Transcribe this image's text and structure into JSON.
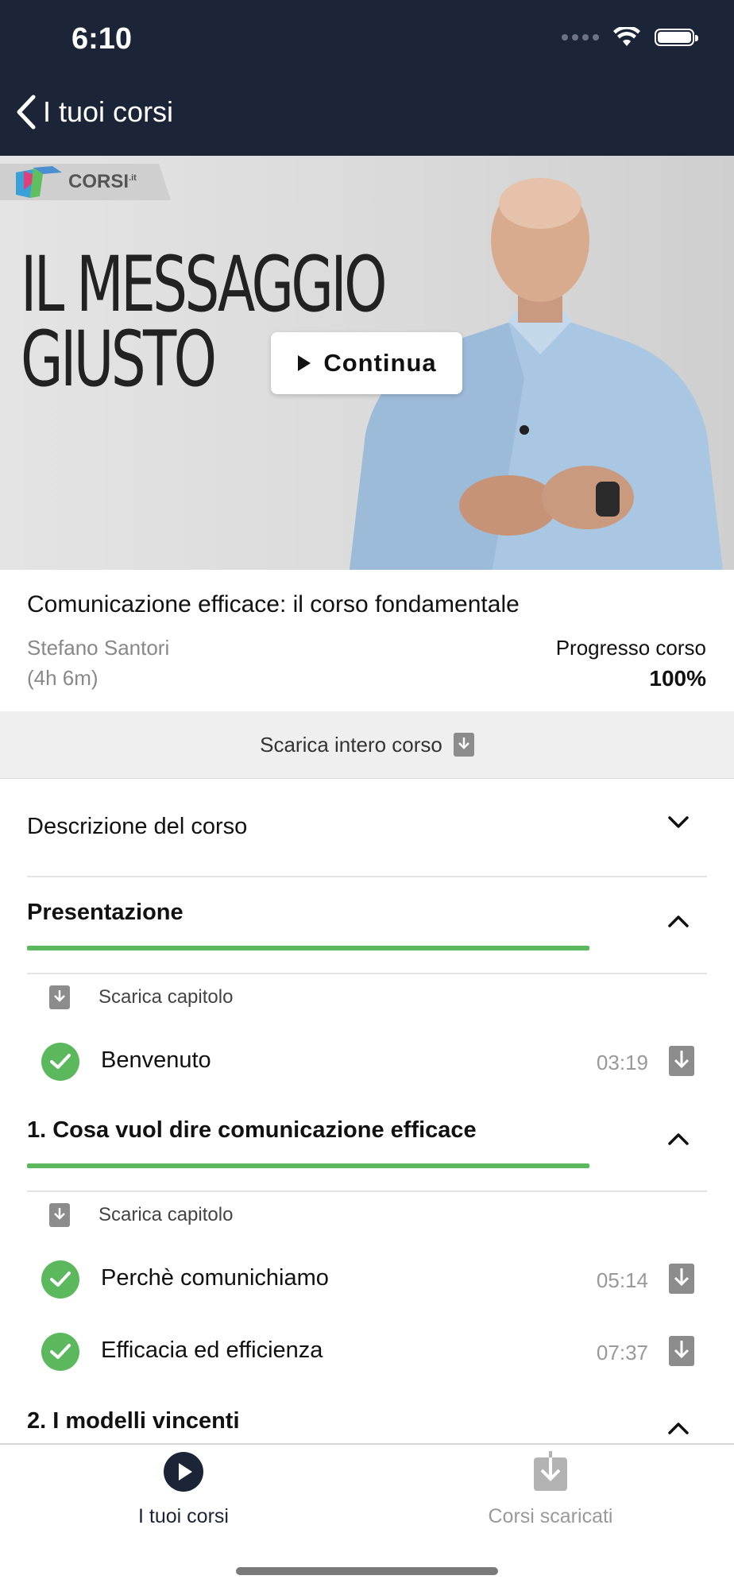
{
  "status_bar": {
    "time": "6:10"
  },
  "header": {
    "back_label": "I tuoi corsi"
  },
  "video": {
    "logo_text": "CORSI",
    "logo_suffix": ".it",
    "title_line1": "IL MESSAGGIO",
    "title_line2": "GIUSTO",
    "continue_label": "Continua"
  },
  "course": {
    "title": "Comunicazione efficace: il corso fondamentale",
    "author": "Stefano Santori",
    "duration": "(4h 6m)",
    "progress_label": "Progresso corso",
    "progress_value": "100%",
    "download_all_label": "Scarica intero corso",
    "description_label": "Descrizione del corso"
  },
  "sections": [
    {
      "title": "Presentazione",
      "progress": 1.0,
      "download_label": "Scarica capitolo",
      "lessons": [
        {
          "title": "Benvenuto",
          "duration": "03:19",
          "completed": true
        }
      ]
    },
    {
      "title": "1. Cosa vuol dire comunicazione efficace",
      "progress": 1.0,
      "download_label": "Scarica capitolo",
      "lessons": [
        {
          "title": "Perchè comunichiamo",
          "duration": "05:14",
          "completed": true
        },
        {
          "title": "Efficacia ed efficienza",
          "duration": "07:37",
          "completed": true
        }
      ]
    },
    {
      "title": "2. I modelli vincenti"
    }
  ],
  "tabbar": {
    "tabs": [
      {
        "label": "I tuoi corsi",
        "icon": "play-circle-icon",
        "active": true
      },
      {
        "label": "Corsi scaricati",
        "icon": "download-icon",
        "active": false
      }
    ]
  },
  "colors": {
    "header_bg": "#1c2438",
    "progress_green": "#5cb85c",
    "inactive_gray": "#999999"
  }
}
